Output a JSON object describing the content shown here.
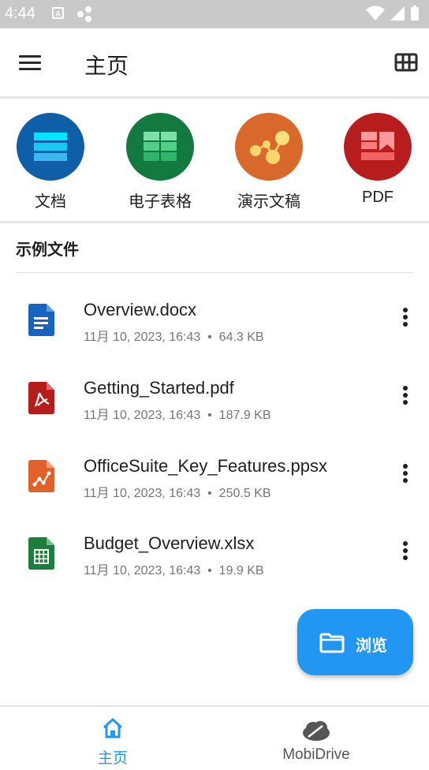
{
  "status_bar": {
    "time": "4:44"
  },
  "app_bar": {
    "title": "主页"
  },
  "categories": [
    {
      "label": "文档",
      "color": "#0f5ea8",
      "icon": "document-icon"
    },
    {
      "label": "电子表格",
      "color": "#137a3f",
      "icon": "spreadsheet-icon"
    },
    {
      "label": "演示文稿",
      "color": "#d9692a",
      "icon": "presentation-icon"
    },
    {
      "label": "PDF",
      "color": "#b71d1d",
      "icon": "pdf-icon"
    }
  ],
  "section": {
    "title": "示例文件"
  },
  "files": [
    {
      "name": "Overview.docx",
      "date": "11月 10, 2023, 16:43",
      "size": "64.3 KB",
      "icon": "docx-file-icon",
      "color": "#1565c0"
    },
    {
      "name": "Getting_Started.pdf",
      "date": "11月 10, 2023, 16:43",
      "size": "187.9 KB",
      "icon": "pdf-file-icon",
      "color": "#b71c1c"
    },
    {
      "name": "OfficeSuite_Key_Features.ppsx",
      "date": "11月 10, 2023, 16:43",
      "size": "250.5 KB",
      "icon": "ppsx-file-icon",
      "color": "#e0622a"
    },
    {
      "name": "Budget_Overview.xlsx",
      "date": "11月 10, 2023, 16:43",
      "size": "19.9 KB",
      "icon": "xlsx-file-icon",
      "color": "#1b7e3d"
    }
  ],
  "meta_separator": "•",
  "fab": {
    "label": "浏览"
  },
  "bottom_nav": [
    {
      "label": "主页",
      "active": true,
      "color": "#2196f3"
    },
    {
      "label": "MobiDrive",
      "active": false,
      "color": "#555555"
    }
  ]
}
